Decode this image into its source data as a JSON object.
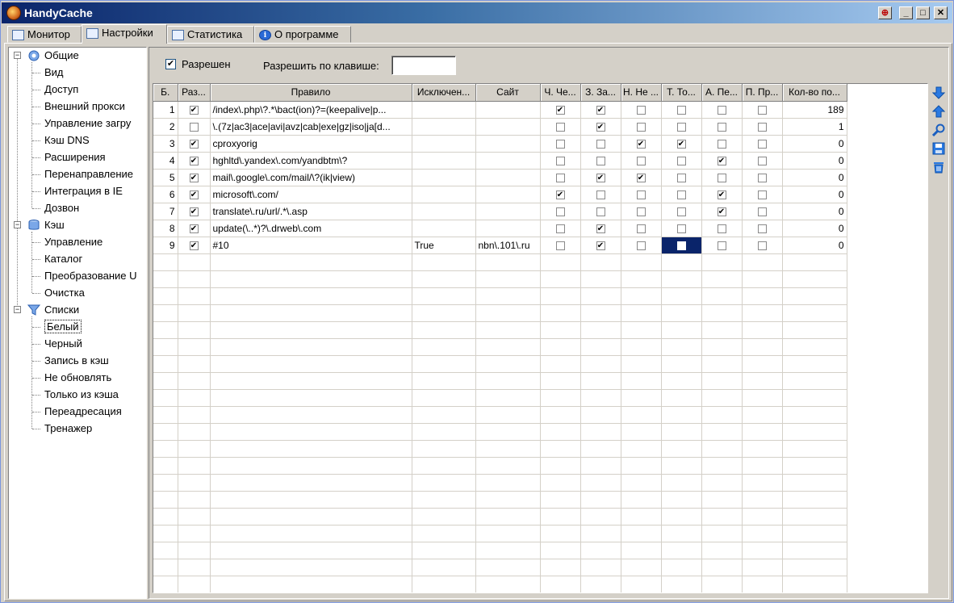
{
  "window": {
    "title": "HandyCache",
    "pin": "⊕",
    "minimize": "_",
    "maximize": "□",
    "close": "✕"
  },
  "tabs": [
    "Монитор",
    "Настройки",
    "Статистика",
    "О программе"
  ],
  "tree": {
    "groups": [
      {
        "label": "Общие",
        "icon": "gear-icon",
        "items": [
          "Вид",
          "Доступ",
          "Внешний прокси",
          "Управление загру",
          "Кэш DNS",
          "Расширения",
          "Перенаправление",
          "Интеграция в IE",
          "Дозвон"
        ]
      },
      {
        "label": "Кэш",
        "icon": "database-icon",
        "items": [
          "Управление",
          "Каталог",
          "Преобразование U",
          "Очистка"
        ]
      },
      {
        "label": "Списки",
        "icon": "filter-icon",
        "items": [
          "Белый",
          "Черный",
          "Запись в кэш",
          "Не обновлять",
          "Только из кэша",
          "Переадресация",
          "Тренажер"
        ]
      }
    ],
    "selected": "Белый"
  },
  "options": {
    "enabled_label": "Разрешен",
    "enabled": true,
    "hotkey_label": "Разрешить по клавише:",
    "hotkey_value": ""
  },
  "grid": {
    "columns": [
      "Б.",
      "Раз...",
      "Правило",
      "Исключен...",
      "Сайт",
      "Ч. Че...",
      "З. За...",
      "Н. Не ...",
      "Т. То...",
      "А. Пе...",
      "П. Пр...",
      "Кол-во по..."
    ],
    "rows": [
      {
        "n": "1",
        "en": true,
        "rule": "/index\\.php\\?.*\\bact(ion)?=(keepalive|p...",
        "exc": "",
        "site": "",
        "flags": [
          true,
          true,
          false,
          false,
          false,
          false
        ],
        "count": "189"
      },
      {
        "n": "2",
        "en": false,
        "rule": "\\.(7z|ac3|ace|avi|avz|cab|exe|gz|iso|ja[d...",
        "exc": "",
        "site": "",
        "flags": [
          false,
          true,
          false,
          false,
          false,
          false
        ],
        "count": "1"
      },
      {
        "n": "3",
        "en": true,
        "rule": "cproxyorig",
        "exc": "",
        "site": "",
        "flags": [
          false,
          false,
          true,
          true,
          false,
          false
        ],
        "count": "0"
      },
      {
        "n": "4",
        "en": true,
        "rule": "hghltd\\.yandex\\.com/yandbtm\\?",
        "exc": "",
        "site": "",
        "flags": [
          false,
          false,
          false,
          false,
          true,
          false
        ],
        "count": "0"
      },
      {
        "n": "5",
        "en": true,
        "rule": "mail\\.google\\.com/mail/\\?(ik|view)",
        "exc": "",
        "site": "",
        "flags": [
          false,
          true,
          true,
          false,
          false,
          false
        ],
        "count": "0"
      },
      {
        "n": "6",
        "en": true,
        "rule": "microsoft\\.com/",
        "exc": "",
        "site": "",
        "flags": [
          true,
          false,
          false,
          false,
          true,
          false
        ],
        "count": "0"
      },
      {
        "n": "7",
        "en": true,
        "rule": "translate\\.ru/url/.*\\.asp",
        "exc": "",
        "site": "",
        "flags": [
          false,
          false,
          false,
          false,
          true,
          false
        ],
        "count": "0"
      },
      {
        "n": "8",
        "en": true,
        "rule": "update(\\..*)?\\.drweb\\.com",
        "exc": "",
        "site": "",
        "flags": [
          false,
          true,
          false,
          false,
          false,
          false
        ],
        "count": "0"
      },
      {
        "n": "9",
        "en": true,
        "rule": "#10",
        "exc": "True",
        "site": "nbn\\.101\\.ru",
        "flags": [
          false,
          true,
          false,
          false,
          false,
          false
        ],
        "count": "0"
      }
    ],
    "focus": {
      "row": 8,
      "flag": 3
    }
  },
  "side_buttons": [
    "move-down-icon",
    "move-up-icon",
    "search-icon",
    "save-icon",
    "delete-icon"
  ],
  "check_glyph": "✔"
}
